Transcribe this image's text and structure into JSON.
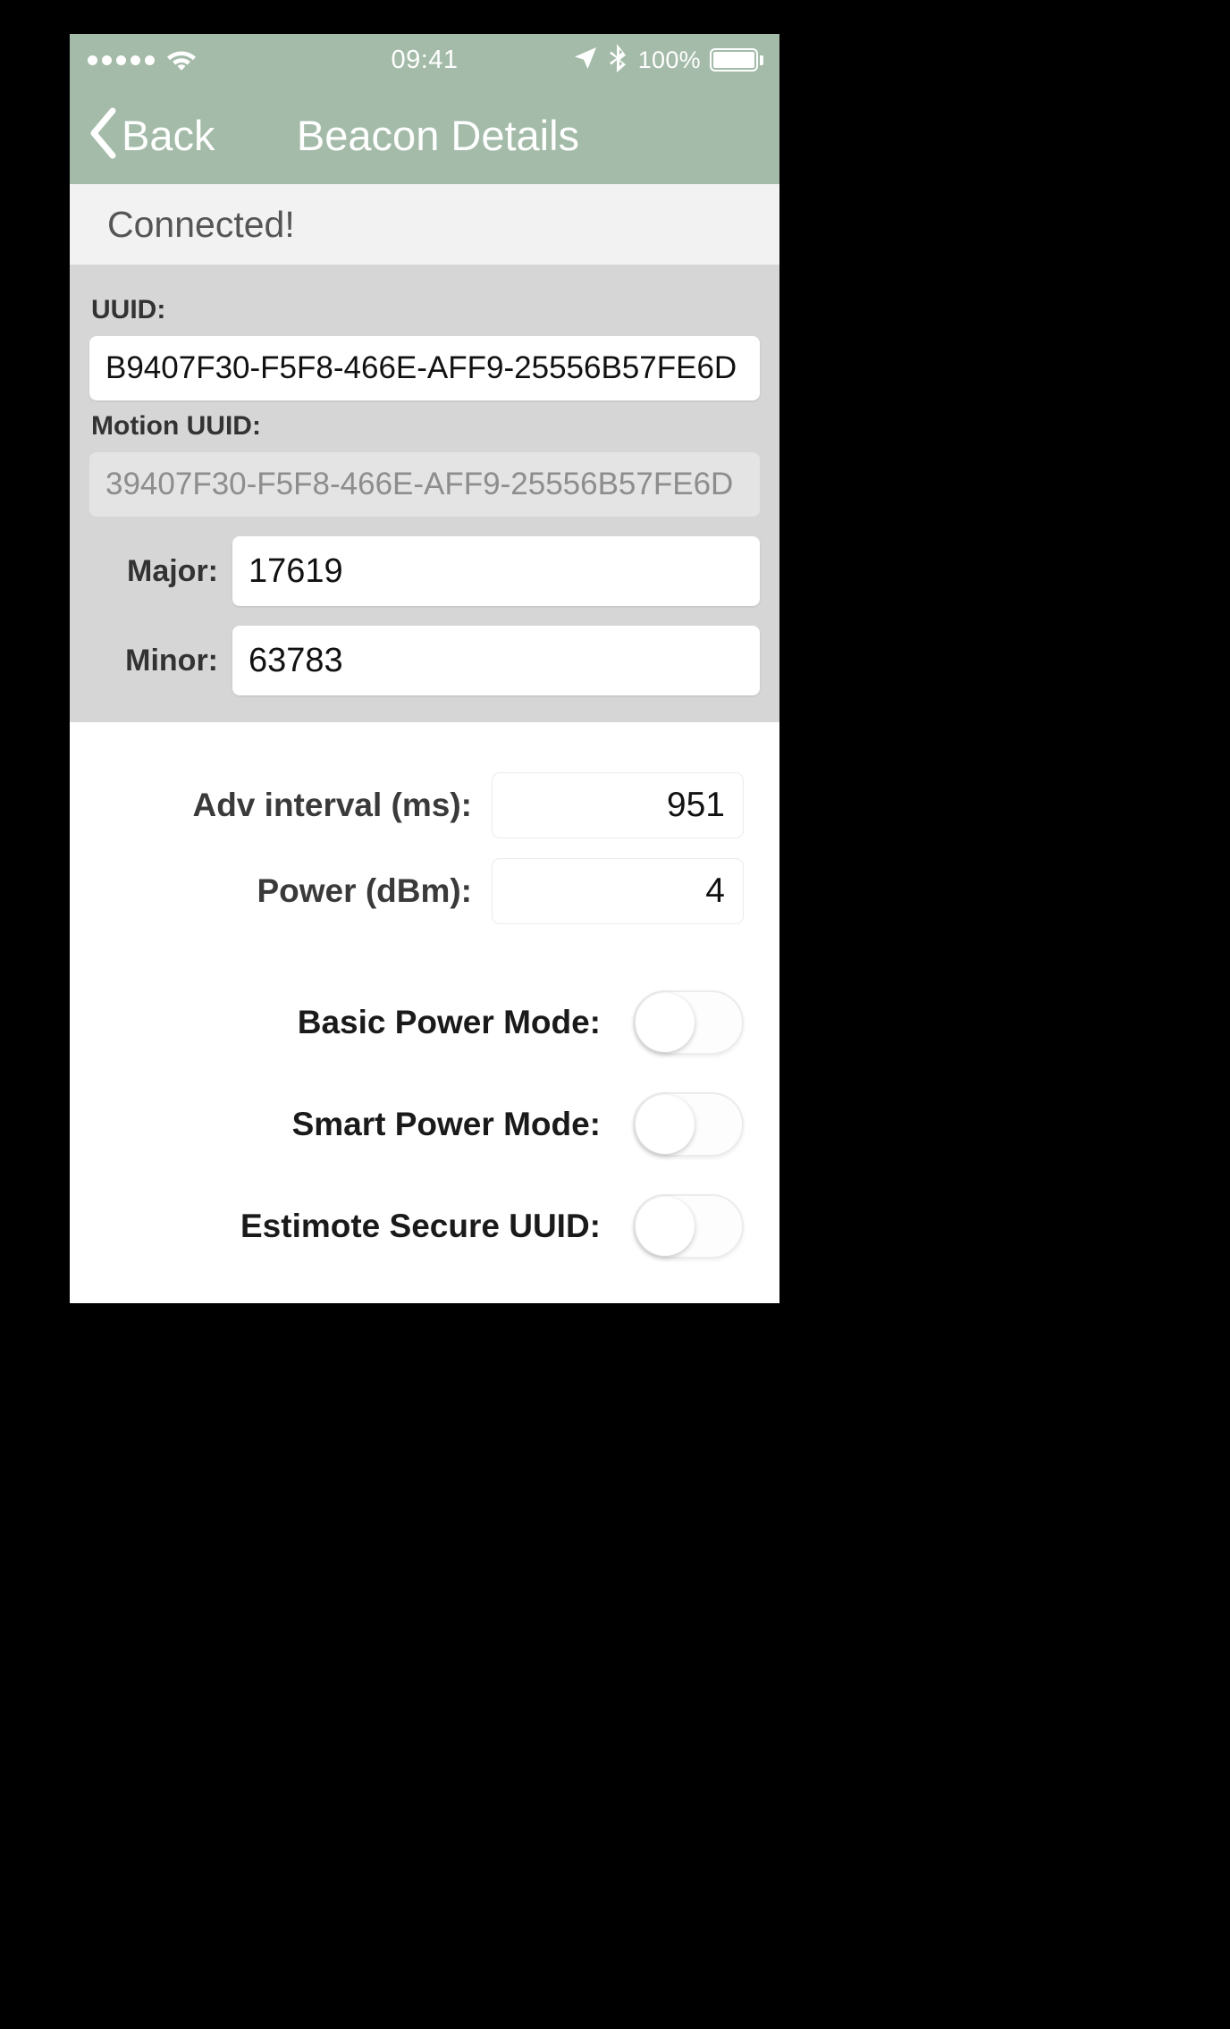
{
  "status_bar": {
    "signal_dots": 5,
    "wifi_icon": "wifi-icon",
    "time": "09:41",
    "location_icon": "location-arrow-icon",
    "bluetooth_icon": "bluetooth-icon",
    "battery_percent": "100%",
    "battery_level": 100
  },
  "nav": {
    "back_label": "Back",
    "back_icon": "chevron-left-icon",
    "title": "Beacon Details"
  },
  "connection": {
    "status_text": "Connected!"
  },
  "identity": {
    "uuid_label": "UUID:",
    "uuid_value": "B9407F30-F5F8-466E-AFF9-25556B57FE6D",
    "motion_uuid_label": "Motion UUID:",
    "motion_uuid_value": "39407F30-F5F8-466E-AFF9-25556B57FE6D",
    "major_label": "Major:",
    "major_value": "17619",
    "minor_label": "Minor:",
    "minor_value": "63783"
  },
  "settings": {
    "adv_interval_label": "Adv interval (ms):",
    "adv_interval_value": "951",
    "power_label": "Power (dBm):",
    "power_value": "4",
    "toggles": [
      {
        "label": "Basic Power Mode:",
        "state": "off"
      },
      {
        "label": "Smart Power Mode:",
        "state": "off"
      },
      {
        "label": "Estimote Secure UUID:",
        "state": "off"
      }
    ]
  },
  "colors": {
    "nav_bar": "#a3bba8",
    "banner_bg": "#f2f2f2",
    "identity_bg": "#d6d6d6",
    "content_bg": "#ffffff",
    "frame_bg": "#000000"
  }
}
